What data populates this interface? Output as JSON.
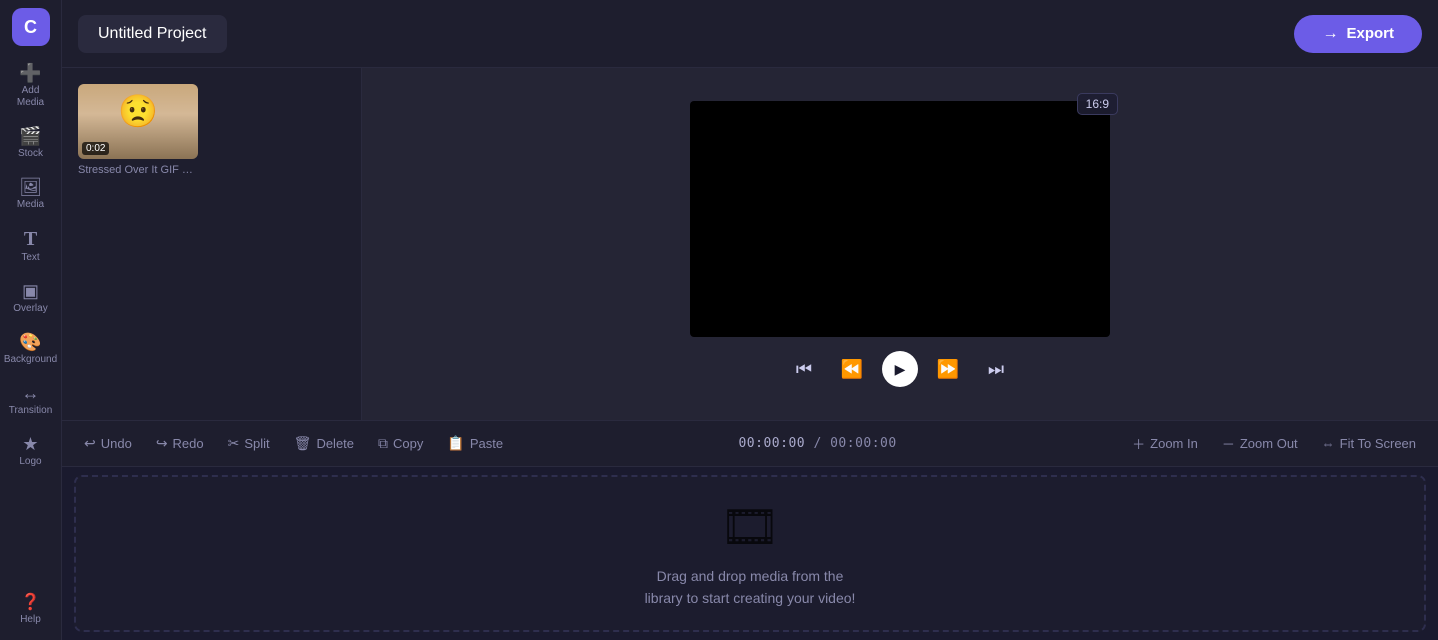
{
  "sidebar": {
    "logo_label": "C",
    "items": [
      {
        "id": "add-media",
        "icon": "➕",
        "label": "Add Media"
      },
      {
        "id": "stock",
        "icon": "🎬",
        "label": "Stock"
      },
      {
        "id": "media",
        "icon": "🖼",
        "label": "Media"
      },
      {
        "id": "text",
        "icon": "T",
        "label": "Text"
      },
      {
        "id": "overlay",
        "icon": "◻",
        "label": "Overlay"
      },
      {
        "id": "background",
        "icon": "🎨",
        "label": "Background"
      },
      {
        "id": "transition",
        "icon": "↔",
        "label": "Transition"
      },
      {
        "id": "logo",
        "icon": "★",
        "label": "Logo"
      },
      {
        "id": "help",
        "icon": "?",
        "label": "Help"
      }
    ]
  },
  "topbar": {
    "project_title": "Untitled Project",
    "export_label": "Export"
  },
  "media_panel": {
    "items": [
      {
        "id": "clip-1",
        "duration": "0:02",
        "label": "Stressed Over It GIF by ..."
      }
    ]
  },
  "preview": {
    "aspect_ratio": "16:9"
  },
  "playback": {
    "skip_start_label": "⏮",
    "rewind_label": "⏪",
    "play_label": "▶",
    "fast_forward_label": "⏩",
    "skip_end_label": "⏭"
  },
  "timeline": {
    "toolbar": {
      "undo_label": "Undo",
      "redo_label": "Redo",
      "split_label": "Split",
      "delete_label": "Delete",
      "copy_label": "Copy",
      "paste_label": "Paste"
    },
    "timecode_current": "00:00:00",
    "timecode_total": "00:00:00",
    "zoom_in_label": "Zoom In",
    "zoom_out_label": "Zoom Out",
    "fit_to_screen_label": "Fit To Screen",
    "drop_zone": {
      "text_line1": "Drag and drop media from the",
      "text_line2": "library to start creating your video!"
    }
  }
}
